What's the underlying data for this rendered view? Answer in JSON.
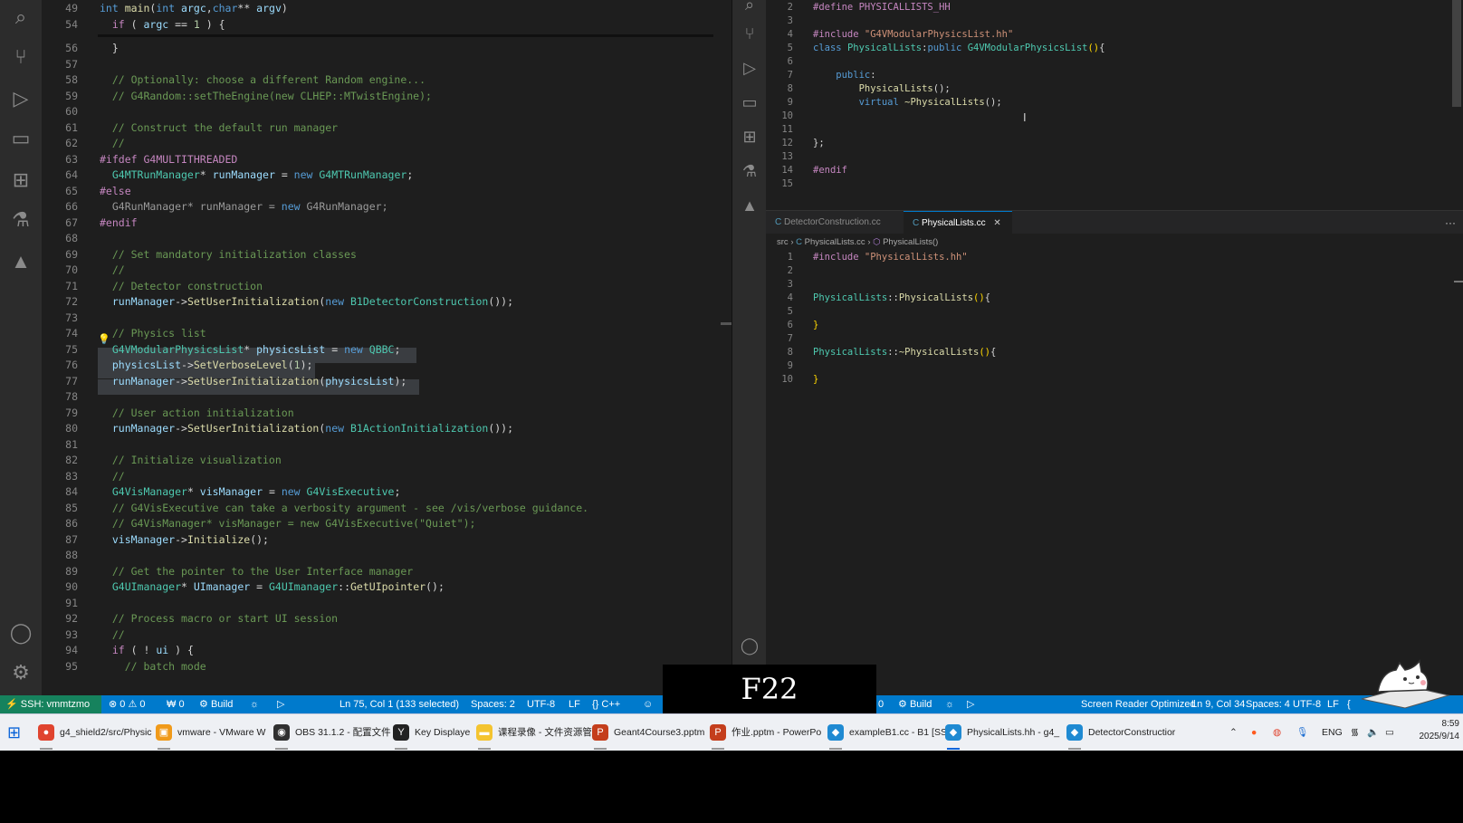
{
  "left_editor": {
    "sticky": [
      {
        "n": "49",
        "parts": [
          [
            "kw",
            "int "
          ],
          [
            "fn",
            "main"
          ],
          [
            "",
            "("
          ],
          [
            "kw",
            "int "
          ],
          [
            "vr",
            "argc"
          ],
          [
            "",
            ","
          ],
          [
            "kw",
            "char"
          ],
          [
            "",
            "** "
          ],
          [
            "vr",
            "argv"
          ],
          [
            "",
            ")"
          ]
        ]
      },
      {
        "n": "54",
        "parts": [
          [
            "",
            "  "
          ],
          [
            "mc",
            "if"
          ],
          [
            "",
            " ( "
          ],
          [
            "vr",
            "argc"
          ],
          [
            "",
            " == "
          ],
          [
            "nm",
            "1"
          ],
          [
            "",
            " ) {"
          ]
        ]
      }
    ],
    "lines": [
      {
        "n": "56",
        "parts": [
          [
            "",
            "  }"
          ]
        ]
      },
      {
        "n": "57",
        "parts": []
      },
      {
        "n": "58",
        "parts": [
          [
            "cm",
            "  // Optionally: choose a different Random engine..."
          ]
        ]
      },
      {
        "n": "59",
        "parts": [
          [
            "cm",
            "  // G4Random::setTheEngine(new CLHEP::MTwistEngine);"
          ]
        ]
      },
      {
        "n": "60",
        "parts": []
      },
      {
        "n": "61",
        "parts": [
          [
            "cm",
            "  // Construct the default run manager"
          ]
        ]
      },
      {
        "n": "62",
        "parts": [
          [
            "cm",
            "  //"
          ]
        ]
      },
      {
        "n": "63",
        "parts": [
          [
            "pp",
            "#ifdef "
          ],
          [
            "pp",
            "G4MULTITHREADED"
          ]
        ]
      },
      {
        "n": "64",
        "parts": [
          [
            "ty",
            "  G4MTRunManager"
          ],
          [
            "",
            "* "
          ],
          [
            "vr",
            "runManager"
          ],
          [
            "",
            " = "
          ],
          [
            "kw",
            "new "
          ],
          [
            "ty",
            "G4MTRunManager"
          ],
          [
            "",
            ";"
          ]
        ]
      },
      {
        "n": "65",
        "parts": [
          [
            "pp",
            "#else"
          ]
        ]
      },
      {
        "n": "66",
        "parts": [
          [
            "dim",
            "  G4RunManager* runManager = "
          ],
          [
            "kw",
            "new "
          ],
          [
            "dim",
            "G4RunManager;"
          ]
        ]
      },
      {
        "n": "67",
        "parts": [
          [
            "pp",
            "#endif"
          ]
        ]
      },
      {
        "n": "68",
        "parts": []
      },
      {
        "n": "69",
        "parts": [
          [
            "cm",
            "  // Set mandatory initialization classes"
          ]
        ]
      },
      {
        "n": "70",
        "parts": [
          [
            "cm",
            "  //"
          ]
        ]
      },
      {
        "n": "71",
        "parts": [
          [
            "cm",
            "  // Detector construction"
          ]
        ]
      },
      {
        "n": "72",
        "parts": [
          [
            "vr",
            "  runManager"
          ],
          [
            "",
            "->"
          ],
          [
            "fn",
            "SetUserInitialization"
          ],
          [
            "",
            "("
          ],
          [
            "kw",
            "new "
          ],
          [
            "ty",
            "B1DetectorConstruction"
          ],
          [
            "",
            "());"
          ]
        ]
      },
      {
        "n": "73",
        "parts": []
      },
      {
        "n": "74",
        "parts": [
          [
            "cm",
            "  // Physics list"
          ]
        ]
      },
      {
        "n": "75",
        "parts": [
          [
            "ty",
            "  G4VModularPhysicsList"
          ],
          [
            "",
            "* "
          ],
          [
            "vr",
            "physicsList"
          ],
          [
            "",
            " = "
          ],
          [
            "kw",
            "new "
          ],
          [
            "ty",
            "QBBC"
          ],
          [
            "",
            ";"
          ]
        ]
      },
      {
        "n": "76",
        "parts": [
          [
            "vr",
            "  physicsList"
          ],
          [
            "",
            "->"
          ],
          [
            "fn",
            "SetVerboseLevel"
          ],
          [
            "",
            "("
          ],
          [
            "nm",
            "1"
          ],
          [
            "",
            ");"
          ]
        ]
      },
      {
        "n": "77",
        "parts": [
          [
            "vr",
            "  runManager"
          ],
          [
            "",
            "->"
          ],
          [
            "fn",
            "SetUserInitialization"
          ],
          [
            "",
            "("
          ],
          [
            "vr",
            "physicsList"
          ],
          [
            "",
            ");"
          ]
        ]
      },
      {
        "n": "78",
        "parts": []
      },
      {
        "n": "79",
        "parts": [
          [
            "cm",
            "  // User action initialization"
          ]
        ]
      },
      {
        "n": "80",
        "parts": [
          [
            "vr",
            "  runManager"
          ],
          [
            "",
            "->"
          ],
          [
            "fn",
            "SetUserInitialization"
          ],
          [
            "",
            "("
          ],
          [
            "kw",
            "new "
          ],
          [
            "ty",
            "B1ActionInitialization"
          ],
          [
            "",
            "());"
          ]
        ]
      },
      {
        "n": "81",
        "parts": []
      },
      {
        "n": "82",
        "parts": [
          [
            "cm",
            "  // Initialize visualization"
          ]
        ]
      },
      {
        "n": "83",
        "parts": [
          [
            "cm",
            "  //"
          ]
        ]
      },
      {
        "n": "84",
        "parts": [
          [
            "ty",
            "  G4VisManager"
          ],
          [
            "",
            "* "
          ],
          [
            "vr",
            "visManager"
          ],
          [
            "",
            " = "
          ],
          [
            "kw",
            "new "
          ],
          [
            "ty",
            "G4VisExecutive"
          ],
          [
            "",
            ";"
          ]
        ]
      },
      {
        "n": "85",
        "parts": [
          [
            "cm",
            "  // G4VisExecutive can take a verbosity argument - see /vis/verbose guidance."
          ]
        ]
      },
      {
        "n": "86",
        "parts": [
          [
            "cm",
            "  // G4VisManager* visManager = new G4VisExecutive(\"Quiet\");"
          ]
        ]
      },
      {
        "n": "87",
        "parts": [
          [
            "vr",
            "  visManager"
          ],
          [
            "",
            "->"
          ],
          [
            "fn",
            "Initialize"
          ],
          [
            "",
            "();"
          ]
        ]
      },
      {
        "n": "88",
        "parts": []
      },
      {
        "n": "89",
        "parts": [
          [
            "cm",
            "  // Get the pointer to the User Interface manager"
          ]
        ]
      },
      {
        "n": "90",
        "parts": [
          [
            "ty",
            "  G4UImanager"
          ],
          [
            "",
            "* "
          ],
          [
            "vr",
            "UImanager"
          ],
          [
            "",
            " = "
          ],
          [
            "ty",
            "G4UImanager"
          ],
          [
            "",
            "::"
          ],
          [
            "fn",
            "GetUIpointer"
          ],
          [
            "",
            "();"
          ]
        ]
      },
      {
        "n": "91",
        "parts": []
      },
      {
        "n": "92",
        "parts": [
          [
            "cm",
            "  // Process macro or start UI session"
          ]
        ]
      },
      {
        "n": "93",
        "parts": [
          [
            "cm",
            "  //"
          ]
        ]
      },
      {
        "n": "94",
        "parts": [
          [
            "mc",
            "  if"
          ],
          [
            "",
            " ( ! "
          ],
          [
            "vr",
            "ui"
          ],
          [
            "",
            " ) {"
          ]
        ]
      },
      {
        "n": "95",
        "parts": [
          [
            "cm",
            "    // batch mode"
          ]
        ]
      }
    ]
  },
  "right_top": {
    "lines": [
      {
        "n": "2",
        "parts": [
          [
            "pp",
            "#define "
          ],
          [
            "pp",
            "PHYSICALLISTS_HH"
          ]
        ]
      },
      {
        "n": "3",
        "parts": []
      },
      {
        "n": "4",
        "parts": [
          [
            "pp",
            "#include "
          ],
          [
            "st",
            "\"G4VModularPhysicsList.hh\""
          ]
        ]
      },
      {
        "n": "5",
        "parts": [
          [
            "kw",
            "class "
          ],
          [
            "ty",
            "PhysicalLists"
          ],
          [
            "",
            ":"
          ],
          [
            "kw",
            "public "
          ],
          [
            "ty",
            "G4VModularPhysicsList"
          ],
          [
            "br",
            "()"
          ],
          [
            "",
            "{"
          ]
        ]
      },
      {
        "n": "6",
        "parts": []
      },
      {
        "n": "7",
        "parts": [
          [
            "kw",
            "    public"
          ],
          [
            "",
            ":"
          ]
        ]
      },
      {
        "n": "8",
        "parts": [
          [
            "fn",
            "        PhysicalLists"
          ],
          [
            "",
            "();"
          ]
        ]
      },
      {
        "n": "9",
        "parts": [
          [
            "kw",
            "        virtual "
          ],
          [
            "fn",
            "~PhysicalLists"
          ],
          [
            "",
            "();"
          ]
        ]
      },
      {
        "n": "10",
        "parts": []
      },
      {
        "n": "11",
        "parts": []
      },
      {
        "n": "12",
        "parts": [
          [
            "",
            "};"
          ]
        ]
      },
      {
        "n": "13",
        "parts": []
      },
      {
        "n": "14",
        "parts": [
          [
            "pp",
            "#endif"
          ]
        ]
      },
      {
        "n": "15",
        "parts": []
      }
    ]
  },
  "tabs": [
    {
      "label": "DetectorConstruction.cc",
      "active": false
    },
    {
      "label": "PhysicalLists.cc",
      "active": true
    }
  ],
  "breadcrumb": {
    "seg1": "src",
    "seg2": "PhysicalLists.cc",
    "seg3": "PhysicalLists()"
  },
  "right_bottom": {
    "lines": [
      {
        "n": "1",
        "parts": [
          [
            "pp",
            "#include "
          ],
          [
            "st",
            "\"PhysicalLists.hh\""
          ]
        ]
      },
      {
        "n": "2",
        "parts": []
      },
      {
        "n": "3",
        "parts": []
      },
      {
        "n": "4",
        "parts": [
          [
            "ty",
            "PhysicalLists"
          ],
          [
            "",
            "::"
          ],
          [
            "fn",
            "PhysicalLists"
          ],
          [
            "br",
            "()"
          ],
          [
            "",
            "{"
          ]
        ]
      },
      {
        "n": "5",
        "parts": []
      },
      {
        "n": "6",
        "parts": [
          [
            "br",
            "}"
          ]
        ]
      },
      {
        "n": "7",
        "parts": []
      },
      {
        "n": "8",
        "parts": [
          [
            "ty",
            "PhysicalLists"
          ],
          [
            "",
            "::"
          ],
          [
            "fn",
            "~PhysicalLists"
          ],
          [
            "br",
            "()"
          ],
          [
            "",
            "{"
          ]
        ]
      },
      {
        "n": "9",
        "parts": []
      },
      {
        "n": "10",
        "parts": [
          [
            "br",
            "}"
          ]
        ]
      }
    ]
  },
  "left_status": {
    "ssh": "SSH: vmmtzmo",
    "errors": "⊗ 0 ⚠ 0",
    "ports": "₩ 0",
    "build": "Build",
    "position": "Ln 75, Col 1 (133 selected)",
    "spaces": "Spaces: 2",
    "encoding": "UTF-8",
    "eol": "LF",
    "lang": "{} C++"
  },
  "right_status": {
    "ports": "0",
    "build": "Build",
    "screen_reader": "Screen Reader Optimized",
    "position": "Ln 9, Col 34",
    "spaces": "Spaces: 4",
    "encoding": "UTF-8",
    "eol": "LF"
  },
  "key_display": "F22",
  "taskbar": {
    "items": [
      {
        "label": "g4_shield2/src/Physic",
        "color": "#e0442f",
        "glyph": "●"
      },
      {
        "label": "vmware - VMware W",
        "color": "#f09a1a",
        "glyph": "▣"
      },
      {
        "label": "OBS 31.1.2 - 配置文件",
        "color": "#303030",
        "glyph": "◉"
      },
      {
        "label": "Key Displaye",
        "color": "#222222",
        "glyph": "Y"
      },
      {
        "label": "课程录像 - 文件资源管",
        "color": "#f4c430",
        "glyph": "▬"
      },
      {
        "label": "Geant4Course3.pptm",
        "color": "#c43e1c",
        "glyph": "P"
      },
      {
        "label": "作业.pptm - PowerPo",
        "color": "#c43e1c",
        "glyph": "P"
      },
      {
        "label": "exampleB1.cc - B1 [SS",
        "color": "#1f8ad2",
        "glyph": "◆"
      },
      {
        "label": "PhysicalLists.hh - g4_",
        "color": "#1f8ad2",
        "glyph": "◆"
      },
      {
        "label": "DetectorConstructior",
        "color": "#1f8ad2",
        "glyph": "◆"
      }
    ],
    "ime": "ENG",
    "time": "8:59",
    "date": "2025/9/14"
  }
}
